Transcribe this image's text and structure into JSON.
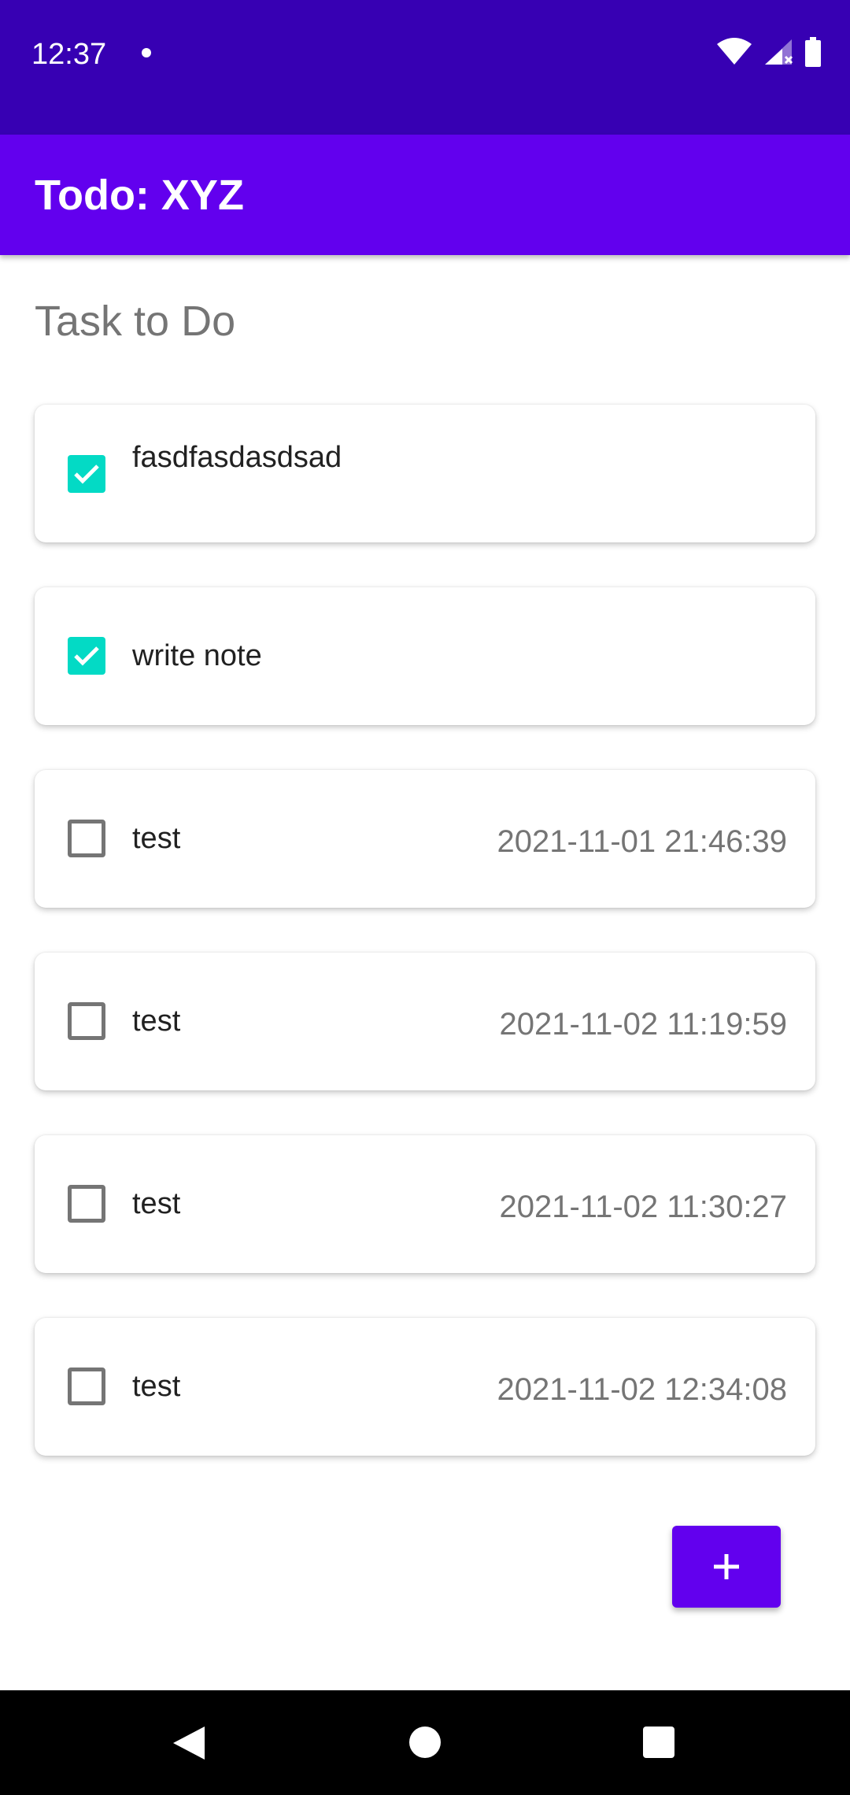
{
  "status_bar": {
    "time": "12:37",
    "icons": [
      "notification-dot-icon",
      "wifi-icon",
      "cell-signal-icon",
      "battery-icon"
    ],
    "background": "#3700b3"
  },
  "app_bar": {
    "title": "Todo: XYZ",
    "background": "#6200ee"
  },
  "main": {
    "section_title": "Task to Do",
    "tasks": [
      {
        "label": "fasdfasdasdsad",
        "checked": true,
        "date": ""
      },
      {
        "label": "write note",
        "checked": true,
        "date": ""
      },
      {
        "label": "test",
        "checked": false,
        "date": "2021-11-01 21:46:39"
      },
      {
        "label": "test",
        "checked": false,
        "date": "2021-11-02 11:19:59"
      },
      {
        "label": "test",
        "checked": false,
        "date": "2021-11-02 11:30:27"
      },
      {
        "label": "test",
        "checked": false,
        "date": "2021-11-02 12:34:08"
      }
    ]
  },
  "fab": {
    "icon": "plus-icon",
    "background": "#6200ee"
  },
  "nav_bar": {
    "icons": [
      "back-icon",
      "home-icon",
      "recents-icon"
    ]
  },
  "colors": {
    "checkbox_checked": "#03dac5",
    "checkbox_unchecked": "#757575"
  }
}
